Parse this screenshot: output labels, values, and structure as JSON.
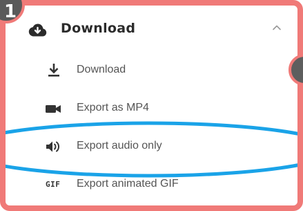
{
  "annotations": {
    "step_number": "1"
  },
  "section": {
    "title": "Download",
    "icon": "cloud-download-icon",
    "state": "expanded"
  },
  "menu": {
    "items": [
      {
        "label": "Download",
        "icon": "download-icon"
      },
      {
        "label": "Export as MP4",
        "icon": "video-camera-icon"
      },
      {
        "label": "Export audio only",
        "icon": "speaker-icon"
      },
      {
        "label": "Export animated GIF",
        "icon": "gif-icon",
        "icon_text": "GIF"
      }
    ]
  },
  "colors": {
    "frame": "#f07a78",
    "highlight": "#1aa3e8",
    "badge": "#5a5a5a",
    "text": "#555555",
    "header_text": "#2b2b2b"
  }
}
